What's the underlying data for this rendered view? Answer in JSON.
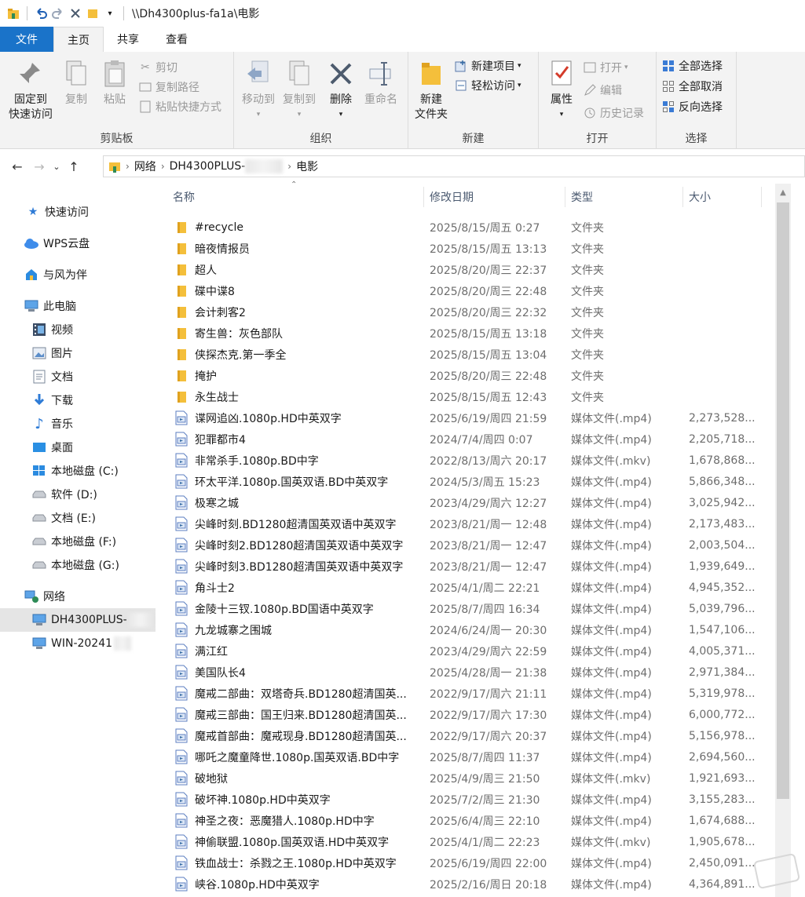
{
  "window": {
    "title": "\\\\Dh4300plus-fa1a\\电影"
  },
  "tabs": [
    "文件",
    "主页",
    "共享",
    "查看"
  ],
  "ribbon": {
    "clipboard": {
      "label": "剪贴板",
      "pin": "固定到\n快速访问",
      "copy": "复制",
      "paste": "粘贴",
      "cut": "剪切",
      "copy_path": "复制路径",
      "paste_shortcut": "粘贴快捷方式"
    },
    "organize": {
      "label": "组织",
      "move_to": "移动到",
      "copy_to": "复制到",
      "delete": "删除",
      "rename": "重命名"
    },
    "new": {
      "label": "新建",
      "new_folder": "新建\n文件夹",
      "new_item": "新建项目",
      "easy_access": "轻松访问"
    },
    "open": {
      "label": "打开",
      "properties": "属性",
      "open": "打开",
      "edit": "编辑",
      "history": "历史记录"
    },
    "select": {
      "label": "选择",
      "select_all": "全部选择",
      "select_none": "全部取消",
      "invert": "反向选择"
    }
  },
  "address": {
    "crumbs": [
      "网络",
      "DH4300PLUS-",
      "电影"
    ]
  },
  "nav": {
    "quick_access": "快速访问",
    "wps": "WPS云盘",
    "yfwb": "与风为伴",
    "this_pc": "此电脑",
    "videos": "视频",
    "pictures": "图片",
    "documents": "文档",
    "downloads": "下载",
    "music": "音乐",
    "desktop": "桌面",
    "drive_c": "本地磁盘 (C:)",
    "drive_d": "软件 (D:)",
    "drive_e": "文档 (E:)",
    "drive_f": "本地磁盘 (F:)",
    "drive_g": "本地磁盘 (G:)",
    "network": "网络",
    "net_dh": "DH4300PLUS-",
    "net_win": "WIN-20241"
  },
  "columns": {
    "name": "名称",
    "date": "修改日期",
    "type": "类型",
    "size": "大小"
  },
  "files": [
    {
      "name": "#recycle",
      "date": "2025/8/15/周五 0:27",
      "type": "文件夹",
      "size": "",
      "kind": "folder"
    },
    {
      "name": "暗夜情报员",
      "date": "2025/8/15/周五 13:13",
      "type": "文件夹",
      "size": "",
      "kind": "folder"
    },
    {
      "name": "超人",
      "date": "2025/8/20/周三 22:37",
      "type": "文件夹",
      "size": "",
      "kind": "folder"
    },
    {
      "name": "碟中谍8",
      "date": "2025/8/20/周三 22:48",
      "type": "文件夹",
      "size": "",
      "kind": "folder"
    },
    {
      "name": "会计刺客2",
      "date": "2025/8/20/周三 22:32",
      "type": "文件夹",
      "size": "",
      "kind": "folder"
    },
    {
      "name": "寄生兽：灰色部队",
      "date": "2025/8/15/周五 13:18",
      "type": "文件夹",
      "size": "",
      "kind": "folder"
    },
    {
      "name": "侠探杰克.第一季全",
      "date": "2025/8/15/周五 13:04",
      "type": "文件夹",
      "size": "",
      "kind": "folder"
    },
    {
      "name": "掩护",
      "date": "2025/8/20/周三 22:48",
      "type": "文件夹",
      "size": "",
      "kind": "folder"
    },
    {
      "name": "永生战士",
      "date": "2025/8/15/周五 12:43",
      "type": "文件夹",
      "size": "",
      "kind": "folder"
    },
    {
      "name": "谍网追凶.1080p.HD中英双字",
      "date": "2025/6/19/周四 21:59",
      "type": "媒体文件(.mp4)",
      "size": "2,273,528...",
      "kind": "media"
    },
    {
      "name": "犯罪都市4",
      "date": "2024/7/4/周四 0:07",
      "type": "媒体文件(.mp4)",
      "size": "2,205,718...",
      "kind": "media"
    },
    {
      "name": "非常杀手.1080p.BD中字",
      "date": "2022/8/13/周六 20:17",
      "type": "媒体文件(.mkv)",
      "size": "1,678,868...",
      "kind": "media"
    },
    {
      "name": "环太平洋.1080p.国英双语.BD中英双字",
      "date": "2024/5/3/周五 15:23",
      "type": "媒体文件(.mp4)",
      "size": "5,866,348...",
      "kind": "media"
    },
    {
      "name": "极寒之城",
      "date": "2023/4/29/周六 12:27",
      "type": "媒体文件(.mp4)",
      "size": "3,025,942...",
      "kind": "media"
    },
    {
      "name": "尖峰时刻.BD1280超清国英双语中英双字",
      "date": "2023/8/21/周一 12:48",
      "type": "媒体文件(.mp4)",
      "size": "2,173,483...",
      "kind": "media"
    },
    {
      "name": "尖峰时刻2.BD1280超清国英双语中英双字",
      "date": "2023/8/21/周一 12:47",
      "type": "媒体文件(.mp4)",
      "size": "2,003,504...",
      "kind": "media"
    },
    {
      "name": "尖峰时刻3.BD1280超清国英双语中英双字",
      "date": "2023/8/21/周一 12:47",
      "type": "媒体文件(.mp4)",
      "size": "1,939,649...",
      "kind": "media"
    },
    {
      "name": "角斗士2",
      "date": "2025/4/1/周二 22:21",
      "type": "媒体文件(.mp4)",
      "size": "4,945,352...",
      "kind": "media"
    },
    {
      "name": "金陵十三钗.1080p.BD国语中英双字",
      "date": "2025/8/7/周四 16:34",
      "type": "媒体文件(.mp4)",
      "size": "5,039,796...",
      "kind": "media"
    },
    {
      "name": "九龙城寨之围城",
      "date": "2024/6/24/周一 20:30",
      "type": "媒体文件(.mp4)",
      "size": "1,547,106...",
      "kind": "media"
    },
    {
      "name": "满江红",
      "date": "2023/4/29/周六 22:59",
      "type": "媒体文件(.mp4)",
      "size": "4,005,371...",
      "kind": "media"
    },
    {
      "name": "美国队长4",
      "date": "2025/4/28/周一 21:38",
      "type": "媒体文件(.mp4)",
      "size": "2,971,384...",
      "kind": "media"
    },
    {
      "name": "魔戒二部曲：双塔奇兵.BD1280超清国英...",
      "date": "2022/9/17/周六 21:11",
      "type": "媒体文件(.mp4)",
      "size": "5,319,978...",
      "kind": "media"
    },
    {
      "name": "魔戒三部曲：国王归来.BD1280超清国英...",
      "date": "2022/9/17/周六 17:30",
      "type": "媒体文件(.mp4)",
      "size": "6,000,772...",
      "kind": "media"
    },
    {
      "name": "魔戒首部曲：魔戒现身.BD1280超清国英...",
      "date": "2022/9/17/周六 20:37",
      "type": "媒体文件(.mp4)",
      "size": "5,156,978...",
      "kind": "media"
    },
    {
      "name": "哪吒之魔童降世.1080p.国英双语.BD中字",
      "date": "2025/8/7/周四 11:37",
      "type": "媒体文件(.mp4)",
      "size": "2,694,560...",
      "kind": "media"
    },
    {
      "name": "破地狱",
      "date": "2025/4/9/周三 21:50",
      "type": "媒体文件(.mkv)",
      "size": "1,921,693...",
      "kind": "media"
    },
    {
      "name": "破坏神.1080p.HD中英双字",
      "date": "2025/7/2/周三 21:30",
      "type": "媒体文件(.mp4)",
      "size": "3,155,283...",
      "kind": "media"
    },
    {
      "name": "神圣之夜：恶魔猎人.1080p.HD中字",
      "date": "2025/6/4/周三 22:10",
      "type": "媒体文件(.mp4)",
      "size": "1,674,688...",
      "kind": "media"
    },
    {
      "name": "神偷联盟.1080p.国英双语.HD中英双字",
      "date": "2025/4/1/周二 22:23",
      "type": "媒体文件(.mkv)",
      "size": "1,905,678...",
      "kind": "media"
    },
    {
      "name": "铁血战士：杀戮之王.1080p.HD中英双字",
      "date": "2025/6/19/周四 22:00",
      "type": "媒体文件(.mp4)",
      "size": "2,450,091...",
      "kind": "media"
    },
    {
      "name": "峡谷.1080p.HD中英双字",
      "date": "2025/2/16/周日 20:18",
      "type": "媒体文件(.mp4)",
      "size": "4,364,891...",
      "kind": "media"
    }
  ],
  "colors": {
    "file_tab": "#1a73c9",
    "folder": "#f4bf3b",
    "selection": "#e5e5e5"
  }
}
